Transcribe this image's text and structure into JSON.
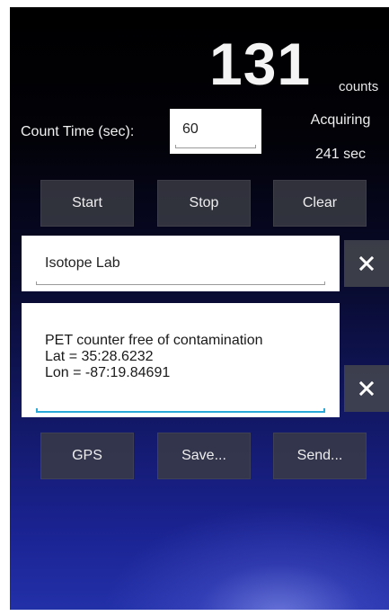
{
  "counter": {
    "count_value": "131",
    "count_unit": "counts",
    "status": "Acquiring",
    "elapsed": "241 sec"
  },
  "count_time": {
    "label": "Count Time (sec):",
    "value": "60"
  },
  "controls": {
    "start_label": "Start",
    "stop_label": "Stop",
    "clear_label": "Clear"
  },
  "location": {
    "value": "Isotope Lab"
  },
  "notes": {
    "lines": [
      "PET counter free of contamination",
      "Lat = 35:28.6232",
      "Lon = -87:19.84691"
    ]
  },
  "actions": {
    "gps_label": "GPS",
    "save_label": "Save...",
    "send_label": "Send..."
  },
  "icons": {
    "clear_field": "close-icon"
  },
  "colors": {
    "background_top": "#000000",
    "background_bottom": "#2230a8",
    "button_bg": "#3a3c44",
    "focus_accent": "#2aa9d8"
  }
}
